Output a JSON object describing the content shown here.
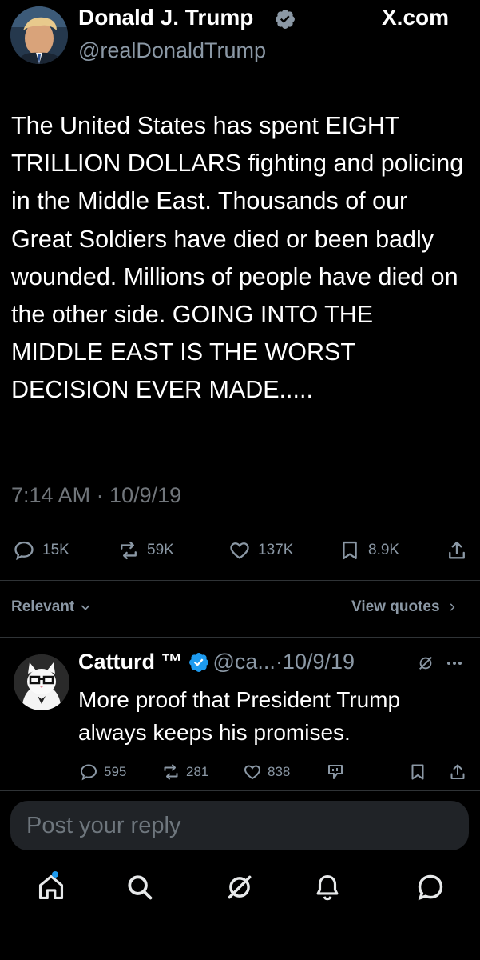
{
  "header": {
    "name": "Donald J. Trump",
    "handle": "@realDonaldTrump",
    "watermark": "X.com",
    "avatar_icon": "profile-photo",
    "verified_icon": "verified-badge"
  },
  "tweet": {
    "text": "The United States has spent EIGHT TRILLION DOLLARS fighting and policing in the Middle East. Thousands of our Great Soldiers have died or been badly wounded. Millions of people have died on the other side. GOING INTO THE MIDDLE EAST IS THE WORST DECISION EVER MADE.....",
    "timestamp": "7:14 AM · 10/9/19",
    "stats": {
      "replies": "15K",
      "reposts": "59K",
      "likes": "137K",
      "bookmarks": "8.9K"
    }
  },
  "filters": {
    "sort_label": "Relevant",
    "quotes_label": "View quotes"
  },
  "reply": {
    "name": "Catturd ™",
    "handle": "@ca...",
    "date": "·10/9/19",
    "text": "More proof that President Trump always keeps his promises.",
    "stats": {
      "replies": "595",
      "reposts": "281",
      "likes": "838"
    }
  },
  "composer": {
    "placeholder": "Post your reply"
  },
  "nav": {
    "items": [
      "home-icon",
      "search-icon",
      "grok-icon",
      "notifications-icon",
      "messages-icon"
    ],
    "accent": "#1d9bf0"
  },
  "colors": {
    "verified": "#1d9bf0",
    "background": "#000000",
    "secondary_text": "#8b98a5"
  }
}
